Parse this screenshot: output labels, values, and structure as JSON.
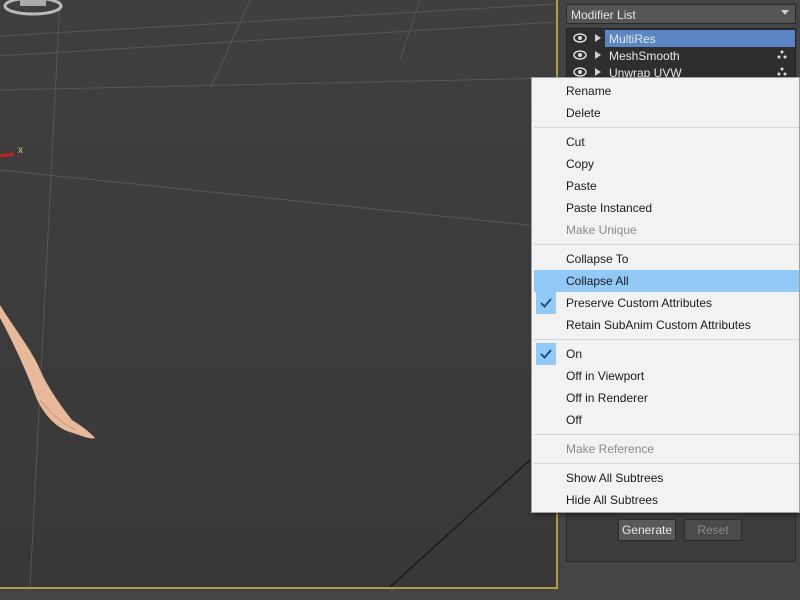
{
  "viewport": {
    "axis_label": "x"
  },
  "modifier_list": {
    "label": "Modifier List"
  },
  "stack": [
    {
      "label": "MultiRes",
      "selected": true
    },
    {
      "label": "MeshSmooth",
      "selected": false
    },
    {
      "label": "Unwrap UVW",
      "selected": false
    }
  ],
  "buttons": {
    "generate": "Generate",
    "reset": "Reset"
  },
  "context_menu": {
    "items": [
      {
        "label": "Rename"
      },
      {
        "label": "Delete"
      },
      {
        "label": "Cut"
      },
      {
        "label": "Copy"
      },
      {
        "label": "Paste"
      },
      {
        "label": "Paste Instanced"
      },
      {
        "label": "Make Unique",
        "disabled": true
      },
      {
        "label": "Collapse To"
      },
      {
        "label": "Collapse All",
        "highlighted": true
      },
      {
        "label": "Preserve Custom Attributes",
        "checked": true
      },
      {
        "label": "Retain SubAnim Custom Attributes"
      },
      {
        "label": "On",
        "checked": true
      },
      {
        "label": "Off in Viewport"
      },
      {
        "label": "Off in Renderer"
      },
      {
        "label": "Off"
      },
      {
        "label": "Make Reference",
        "disabled": true
      },
      {
        "label": "Show All Subtrees"
      },
      {
        "label": "Hide All Subtrees"
      }
    ]
  },
  "colors": {
    "highlight": "#91c9f7",
    "selection": "#5a86c3",
    "viewport_border": "#b39b40"
  }
}
